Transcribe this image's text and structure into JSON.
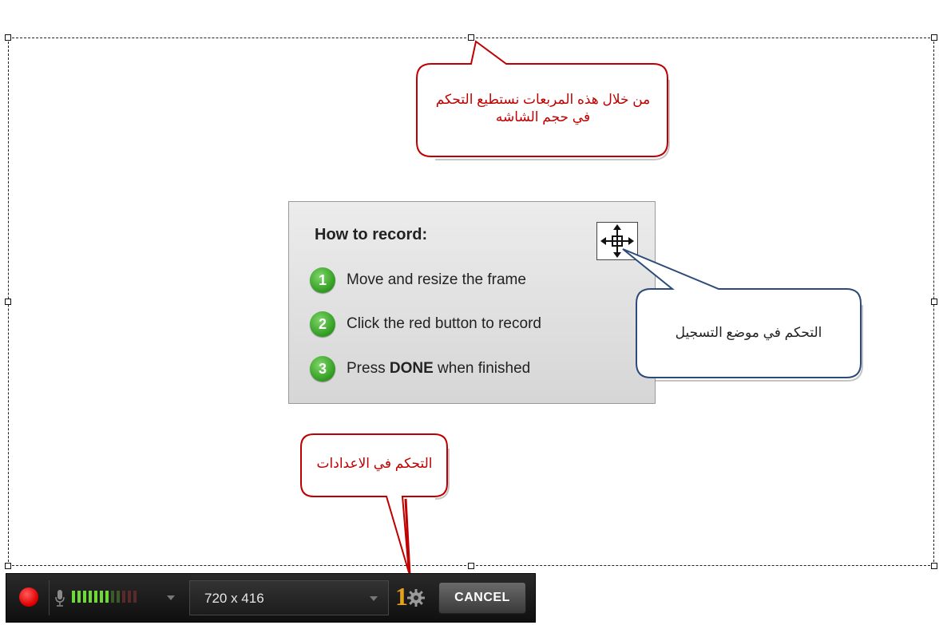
{
  "panel": {
    "title": "How to record:",
    "steps": [
      {
        "num": "1",
        "text": "Move and resize the frame"
      },
      {
        "num": "2",
        "text": "Click the red button to record"
      },
      {
        "num": "3",
        "pre": "Press ",
        "bold": "DONE",
        "post": " when finished"
      }
    ]
  },
  "callouts": {
    "resize": "من خلال هذه المربعات نستطيع التحكم في حجم الشاشه",
    "move": "التحكم في موضع التسجيل",
    "settings": "التحكم في الاعدادات"
  },
  "toolbar": {
    "size_value": "720 x 416",
    "settings_badge": "1",
    "cancel_label": "CANCEL",
    "mic_level": 0.58
  },
  "colors": {
    "callout_red": "#c00000",
    "callout_blue": "#2c4a7a",
    "record_red": "#e00000",
    "step_green": "#2f9a1f",
    "level_green": "#6fd93a"
  },
  "icons": {
    "record": "record-dot-icon",
    "mic": "microphone-icon",
    "move": "move-arrows-icon",
    "settings": "gear-icon"
  }
}
